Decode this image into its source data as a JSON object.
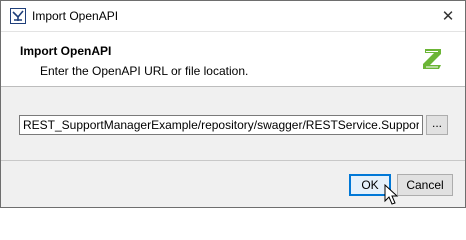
{
  "window": {
    "title": "Import OpenAPI",
    "close_glyph": "✕",
    "icon": "app-icon"
  },
  "header": {
    "title": "Import OpenAPI",
    "description": "Enter the OpenAPI URL or file location.",
    "logo_icon": "openapi-logo-icon",
    "logo_color": "#6bb535"
  },
  "form": {
    "location_value": "REST_SupportManagerExample/repository/swagger/RESTService.SupportAPI.yaml",
    "browse_label": "..."
  },
  "footer": {
    "ok_label": "OK",
    "cancel_label": "Cancel"
  },
  "colors": {
    "accent": "#0078d7"
  }
}
